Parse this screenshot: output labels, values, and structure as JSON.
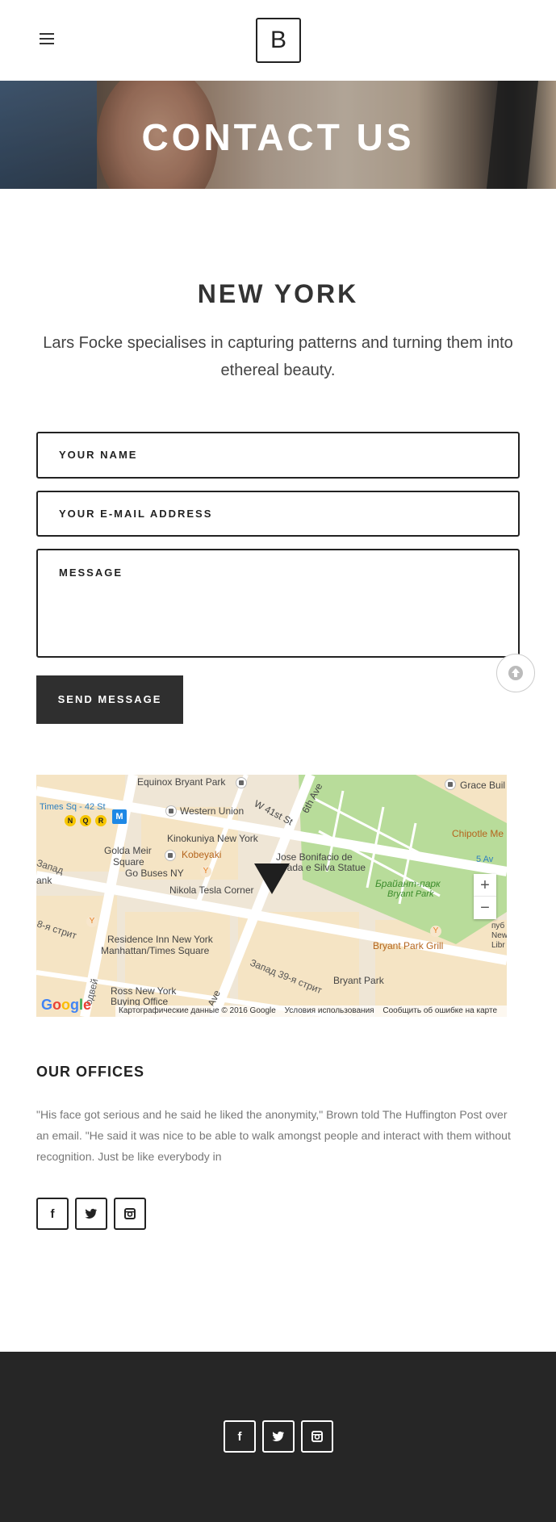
{
  "header": {
    "menu_icon": "hamburger-icon",
    "logo_letter": "B"
  },
  "hero": {
    "title": "CONTACT US"
  },
  "main": {
    "city_title": "NEW YORK",
    "intro": "Lars Focke specialises in capturing patterns and turning them into ethereal beauty."
  },
  "form": {
    "name_placeholder": "YOUR NAME",
    "email_placeholder": "YOUR E-MAIL ADDRESS",
    "message_placeholder": "MESSAGE",
    "submit_label": "SEND MESSAGE"
  },
  "scroll_top_icon": "arrow-up-icon",
  "map": {
    "labels": {
      "equinox": "Equinox Bryant Park",
      "grace": "Grace Buil",
      "times_sq": "Times Sq - 42 St",
      "western_union": "Western Union",
      "w41": "W 41st St",
      "sixth_ave": "6th Ave",
      "chipotle": "Chipotle Me",
      "kinokuniya": "Kinokuniya New York",
      "golda": "Golda Meir",
      "square": "Square",
      "kobeyaki": "Kobeyaki",
      "jose": "Jose Bonifacio de",
      "andrada": "drada e Silva Statue",
      "five_av": "5 Av",
      "zapad_left": "Запад",
      "go_buses": "Go Buses NY",
      "bryant_park_ru": "Брайант-парк",
      "bryant_park_en": "Bryant Park",
      "bank": "ank",
      "tesla": "Nikola Tesla Corner",
      "street_ru": "8-я стрит",
      "residence": "Residence Inn New York",
      "manhattan": "Manhattan/Times Square",
      "bryant_grill": "Bryant Park Grill",
      "zapad_39": "Запад 39-я стрит",
      "bryant_park2": "Bryant Park",
      "ross": "Ross New York",
      "buying": "Buying Office",
      "ave": "Ave",
      "avenue_ru": "одвей",
      "pub1": "пуб",
      "pub2": "New",
      "pub3": "Libr"
    },
    "metro_lines": [
      "N",
      "Q",
      "R"
    ],
    "metro_badge": "M",
    "zoom_in": "+",
    "zoom_out": "−",
    "google_letters": [
      "G",
      "o",
      "o",
      "g",
      "l",
      "e"
    ],
    "attribution": {
      "data": "Картографические данные © 2016 Google",
      "terms": "Условия использования",
      "report": "Сообщить об ошибке на карте"
    }
  },
  "offices": {
    "title": "OUR OFFICES",
    "text": "\"His face got serious and he said he liked the anonymity,\" Brown told The Huffington Post over an email. \"He said it was nice to be able to walk amongst people and interact with them without recognition. Just be like everybody in"
  },
  "social": {
    "facebook": "f",
    "twitter": "twitter-bird",
    "instagram": "instagram-camera"
  },
  "colors": {
    "dark": "#2f2f2f",
    "footer": "#262626",
    "park_green": "#b8dc9a",
    "map_bg": "#efe6d6"
  }
}
